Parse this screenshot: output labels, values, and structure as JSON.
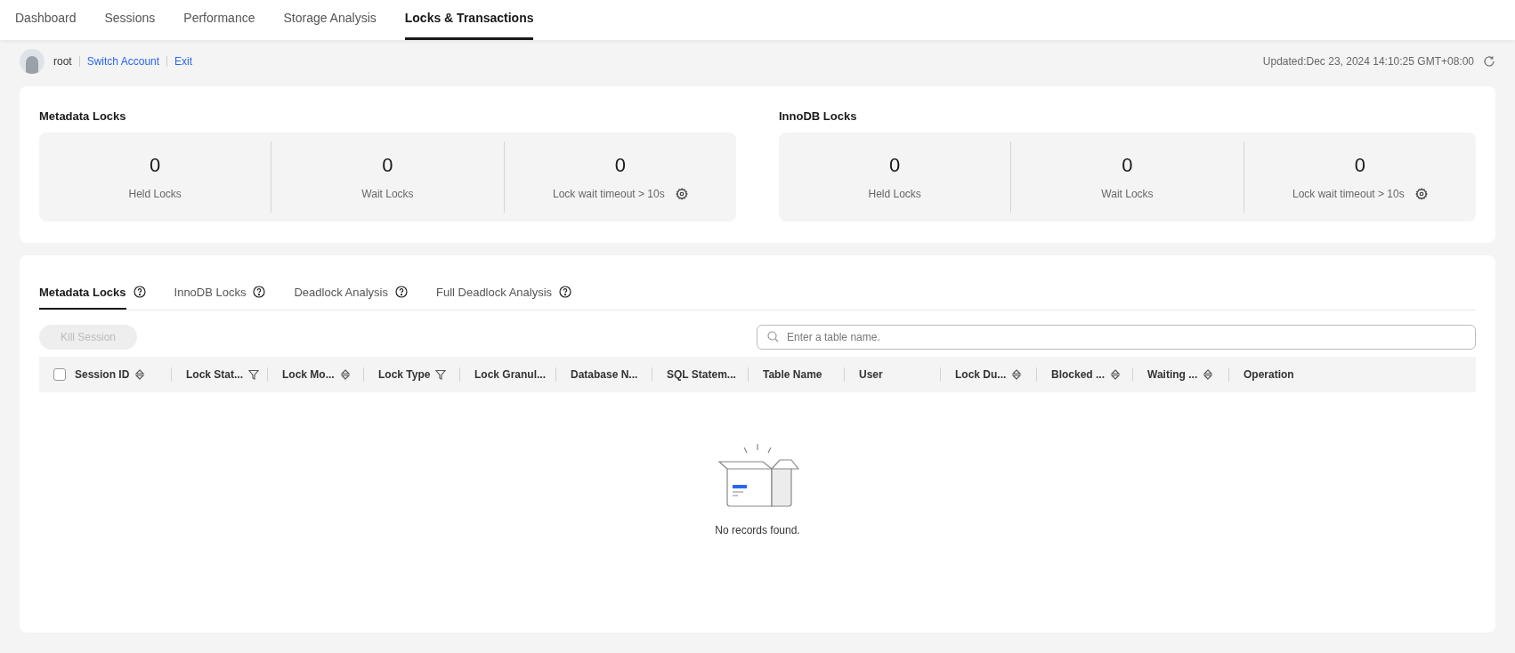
{
  "nav_tabs": [
    {
      "label": "Dashboard",
      "selected": false
    },
    {
      "label": "Sessions",
      "selected": false
    },
    {
      "label": "Performance",
      "selected": false
    },
    {
      "label": "Storage Analysis",
      "selected": false
    },
    {
      "label": "Locks & Transactions",
      "selected": true
    }
  ],
  "account": {
    "user": "root",
    "links": [
      "Switch Account",
      "Exit"
    ],
    "updated": "Updated:Dec 23, 2024 14:10:25 GMT+08:00"
  },
  "summaries": [
    {
      "title": "Metadata Locks",
      "stats": [
        {
          "value": "0",
          "label": "Held Locks",
          "settings": false
        },
        {
          "value": "0",
          "label": "Wait Locks",
          "settings": false
        },
        {
          "value": "0",
          "label": "Lock wait timeout > 10s",
          "settings": true
        }
      ]
    },
    {
      "title": "InnoDB Locks",
      "stats": [
        {
          "value": "0",
          "label": "Held Locks",
          "settings": false
        },
        {
          "value": "0",
          "label": "Wait Locks",
          "settings": false
        },
        {
          "value": "0",
          "label": "Lock wait timeout > 10s",
          "settings": true
        }
      ]
    }
  ],
  "detail_tabs": [
    {
      "label": "Metadata Locks",
      "selected": true
    },
    {
      "label": "InnoDB Locks",
      "selected": false
    },
    {
      "label": "Deadlock Analysis",
      "selected": false
    },
    {
      "label": "Full Deadlock Analysis",
      "selected": false
    }
  ],
  "kill_button": {
    "label": "Kill Session",
    "disabled": true
  },
  "search": {
    "placeholder": "Enter a table name."
  },
  "table": {
    "select_all_checked": false,
    "columns": [
      {
        "label": "Session ID",
        "kind": "sort"
      },
      {
        "label": "Lock Stat...",
        "kind": "filter"
      },
      {
        "label": "Lock Mo...",
        "kind": "sort"
      },
      {
        "label": "Lock Type",
        "kind": "filter"
      },
      {
        "label": "Lock Granul...",
        "kind": "plain"
      },
      {
        "label": "Database N...",
        "kind": "plain"
      },
      {
        "label": "SQL Statem...",
        "kind": "plain"
      },
      {
        "label": "Table Name",
        "kind": "plain"
      },
      {
        "label": "User",
        "kind": "plain"
      },
      {
        "label": "Lock Du...",
        "kind": "sort"
      },
      {
        "label": "Blocked ...",
        "kind": "sort"
      },
      {
        "label": "Waiting ...",
        "kind": "sort"
      },
      {
        "label": "Operation",
        "kind": "plain"
      }
    ],
    "empty_text": "No records found."
  }
}
